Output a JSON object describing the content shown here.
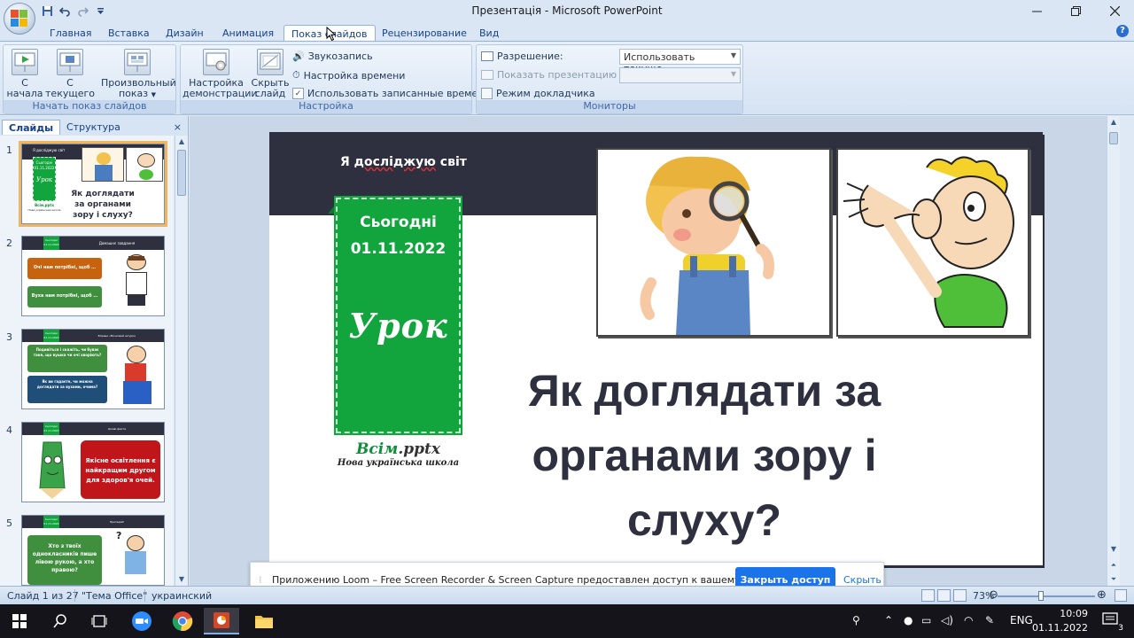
{
  "window": {
    "title": "Презентація - Microsoft PowerPoint",
    "qat": [
      "save-icon",
      "undo-icon",
      "redo-icon",
      "customize-icon"
    ]
  },
  "ribbon": {
    "tabs": [
      "Главная",
      "Вставка",
      "Дизайн",
      "Анимация",
      "Показ слайдов",
      "Рецензирование",
      "Вид"
    ],
    "active_tab": "Показ слайдов",
    "groups": {
      "start": {
        "label": "Начать показ слайдов",
        "from_start": "С начала",
        "from_current": "С текущего слайда",
        "custom": "Произвольный показ"
      },
      "setup": {
        "label": "Настройка",
        "setup_show": "Настройка демонстрации",
        "hide_slide": "Скрыть слайд",
        "record": "Звукозапись",
        "timings": "Настройка времени",
        "use_timings": "Использовать записанные времена"
      },
      "monitors": {
        "label": "Мониторы",
        "resolution_label": "Разрешение:",
        "resolution_value": "Использовать текуще...",
        "show_on_label": "Показать презентацию на:",
        "presenter_view": "Режим докладчика"
      }
    }
  },
  "leftpanel": {
    "tabs": [
      "Слайды",
      "Структура"
    ],
    "close": "×",
    "thumbnails": [
      {
        "num": "1",
        "title": "Як доглядати за органами зору і слуху?",
        "topic": "Я досліджую світ",
        "today": "Сьогодні",
        "date": "01.11.2022",
        "lesson": "Урок",
        "brand": "Всім.pptx",
        "brand_sub": "Нова українська школа"
      },
      {
        "num": "2",
        "today": "Сьогодні",
        "date": "01.11.2022",
        "header": "Домашнє завдання",
        "box1": "Очі нам потрібні, щоб …",
        "box2": "Вуха нам потрібні, щоб …"
      },
      {
        "num": "3",
        "today": "Сьогодні",
        "date": "01.11.2022",
        "header": "Вправа «Мозковий штурм»",
        "box1": "Подивіться і скажіть, чи буває таке, що вушка чи очі хворіють?",
        "box2": "Як ви гадаєте, чи можна доглядати за вухами, очима?"
      },
      {
        "num": "4",
        "today": "Сьогодні",
        "date": "01.11.2022",
        "header": "Цікаві факти",
        "box1": "Якісне освітлення є найкращим другом для здоров'я очей."
      },
      {
        "num": "5",
        "today": "Сьогодні",
        "date": "01.11.2022",
        "header": "Пригадай!",
        "box1": "Хто з твоїх однокласників пише лівою рукою, а хто правою?",
        "mark": "?"
      }
    ]
  },
  "slide": {
    "topic": "Я досліджую світ",
    "topic_plain": "Я ",
    "topic_underlined": "досліджую",
    "topic_rest": " світ",
    "today": "Сьогодні",
    "date": "01.11.2022",
    "lesson": "Урок",
    "brand": "Всім",
    "brand_ext": ".pptx",
    "brand_sub": "Нова українська школа",
    "title_lines": [
      "Як доглядати за",
      "органами зору і",
      "слуху?"
    ]
  },
  "loom": {
    "message": "Приложению Loom – Free Screen Recorder & Screen Capture предоставлен доступ к вашему экрану.",
    "stop_button": "Закрыть доступ",
    "hide_link": "Скрыть"
  },
  "statusbar": {
    "slide_counter": "Слайд 1 из 27",
    "theme": "\"Тема Office\"",
    "language": "украинский",
    "zoom": "73%",
    "zoom_value": 73
  },
  "taskbar": {
    "apps": [
      "windows-start-icon",
      "search-icon",
      "task-view-icon",
      "zoom-icon",
      "chrome-icon",
      "powerpoint-icon",
      "file-explorer-icon"
    ],
    "active_app": "powerpoint-icon",
    "lang": "ENG",
    "time": "10:09",
    "date": "01.11.2022",
    "notifications": "3"
  },
  "colors": {
    "slide_dark": "#2e3040",
    "slide_green": "#12a53d",
    "loom_blue": "#1a73e8",
    "selection_orange": "#f2b45c"
  }
}
